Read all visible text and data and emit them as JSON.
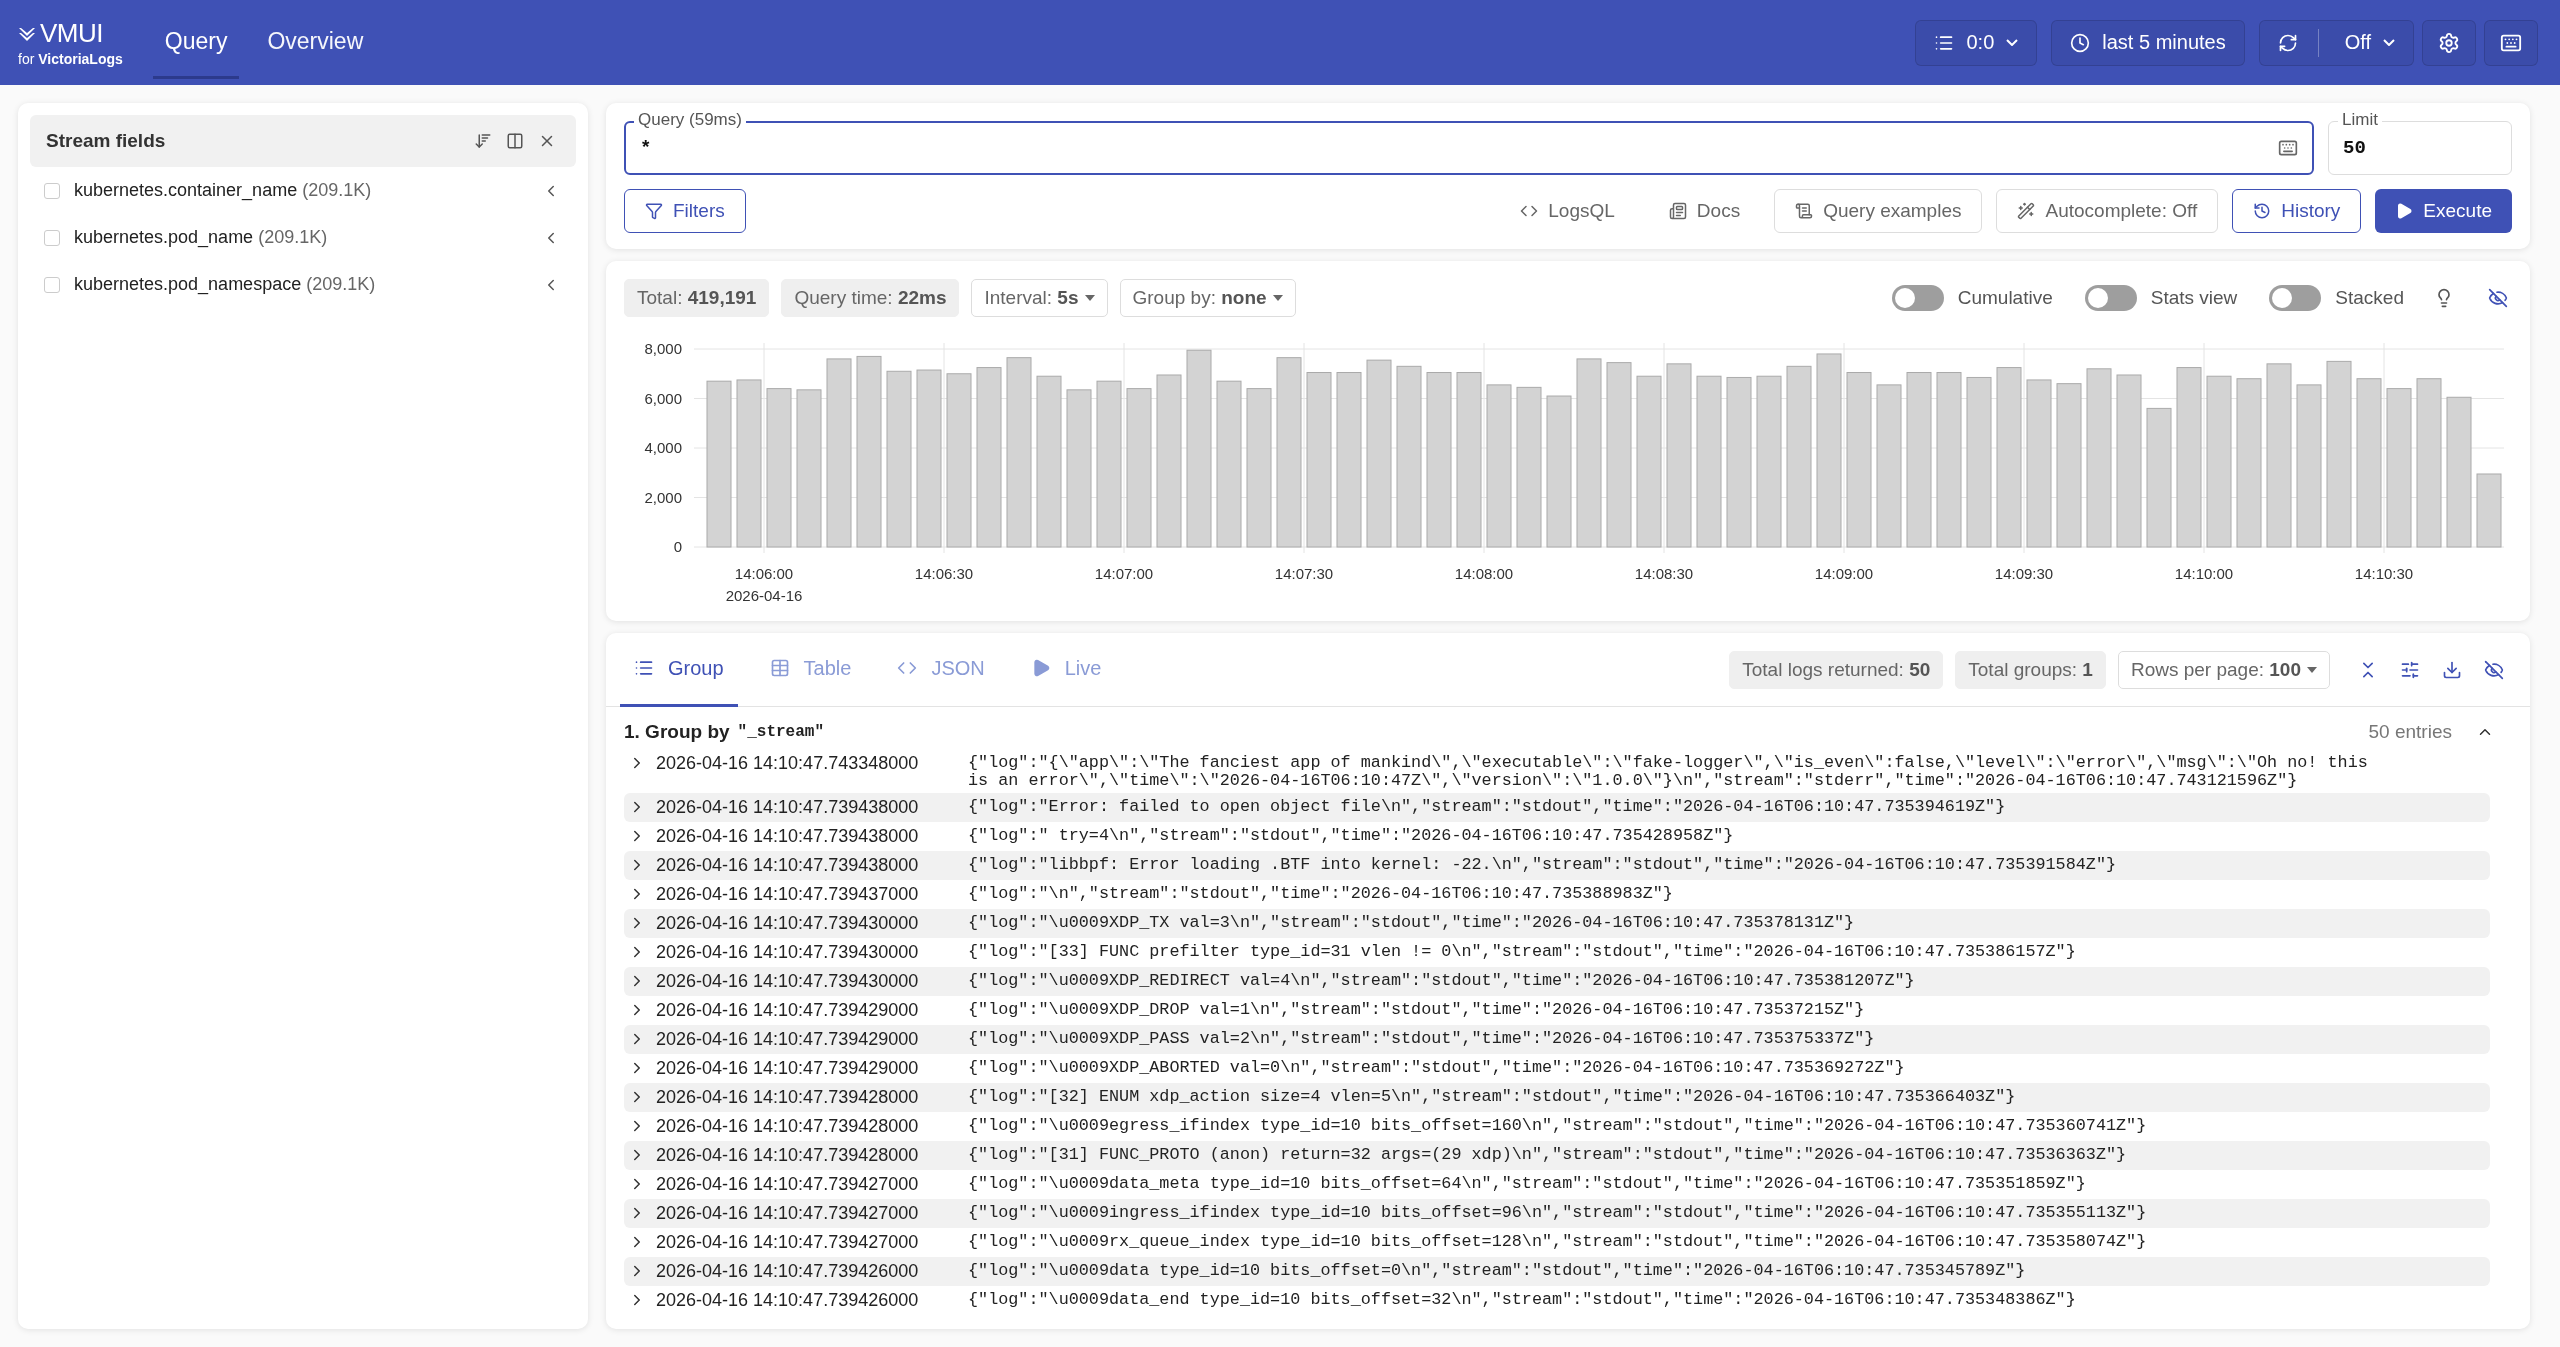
{
  "header": {
    "logo": {
      "title": "VMUI",
      "subtitle": "for **VictoriaLogs**"
    },
    "nav": [
      {
        "label": "Query",
        "selected": true
      },
      {
        "label": "Overview",
        "selected": false
      }
    ],
    "tenant": "0:0",
    "time_range": "last 5 minutes",
    "refresh": "Off"
  },
  "sidebar": {
    "title": "Stream fields",
    "fields": [
      {
        "name": "kubernetes.container_name",
        "count": "(209.1K)",
        "checked": false
      },
      {
        "name": "kubernetes.pod_name",
        "count": "(209.1K)",
        "checked": false
      },
      {
        "name": "kubernetes.pod_namespace",
        "count": "(209.1K)",
        "checked": false
      }
    ]
  },
  "query": {
    "label": "Query (59ms)",
    "value": "*",
    "limit_label": "Limit",
    "limit": "50",
    "buttons": [
      {
        "kind": "outline",
        "label": "Filters"
      },
      {
        "kind": "text",
        "label": "LogsQL"
      },
      {
        "kind": "text",
        "label": "Docs"
      },
      {
        "kind": "plain",
        "label": "Query examples"
      },
      {
        "kind": "plain",
        "label": "Autocomplete: Off"
      },
      {
        "kind": "outline",
        "label": "History"
      },
      {
        "kind": "primary",
        "label": "Execute"
      }
    ]
  },
  "stats": {
    "chips": [
      {
        "kind": "chip",
        "text": "Total: **419,191**"
      },
      {
        "kind": "chip",
        "text": "Query time: **22ms**"
      },
      {
        "kind": "dropdown",
        "text": "Interval: **5s**"
      },
      {
        "kind": "dropdown",
        "text": "Group by: **none**"
      }
    ],
    "toggles": [
      {
        "label": "Cumulative",
        "on": false
      },
      {
        "label": "Stats view",
        "on": false
      },
      {
        "label": "Stacked",
        "on": false
      }
    ],
    "chart_data": {
      "type": "bar",
      "grid": true,
      "ylim": [
        0,
        8000
      ],
      "yticks": [
        {
          "value": 0,
          "label": "0"
        },
        {
          "value": 2000,
          "label": "2,000"
        },
        {
          "value": 4000,
          "label": "4,000"
        },
        {
          "value": 6000,
          "label": "6,000"
        },
        {
          "value": 8000,
          "label": "8,000"
        }
      ],
      "categories": [
        null,
        null,
        "14:06:00",
        null,
        null,
        null,
        null,
        null,
        "14:06:30",
        null,
        null,
        null,
        null,
        null,
        "14:07:00",
        null,
        null,
        null,
        null,
        null,
        "14:07:30",
        null,
        null,
        null,
        null,
        null,
        "14:08:00",
        null,
        null,
        null,
        null,
        null,
        "14:08:30",
        null,
        null,
        null,
        null,
        null,
        "14:09:00",
        null,
        null,
        null,
        null,
        null,
        "14:09:30",
        null,
        null,
        null,
        null,
        null,
        "14:10:00",
        null,
        null,
        null,
        null,
        null,
        "14:10:30",
        null,
        null,
        null
      ],
      "values": [
        6700,
        6750,
        6400,
        6350,
        7600,
        7700,
        7100,
        7150,
        7000,
        7250,
        7650,
        6900,
        6350,
        6700,
        6400,
        6950,
        7950,
        6700,
        6400,
        7650,
        7050,
        7050,
        7550,
        7300,
        7050,
        7050,
        6550,
        6450,
        6100,
        7600,
        7450,
        6900,
        7400,
        6900,
        6850,
        6900,
        7300,
        7800,
        7050,
        6550,
        7050,
        7050,
        6850,
        7250,
        6750,
        6600,
        7200,
        6950,
        5600,
        7250,
        6900,
        6800,
        7400,
        6550,
        7500,
        6800,
        6400,
        6800,
        6050,
        2950
      ],
      "annotations": [
        "2026-04-16"
      ]
    }
  },
  "results": {
    "tabs": [
      {
        "label": "Group",
        "selected": true
      },
      {
        "label": "Table",
        "selected": false
      },
      {
        "label": "JSON",
        "selected": false
      },
      {
        "label": "Live",
        "selected": false
      }
    ],
    "chips": [
      {
        "kind": "chip",
        "text": "Total logs returned: **50**"
      },
      {
        "kind": "chip",
        "text": "Total groups: **1**"
      },
      {
        "kind": "dropdown",
        "text": "Rows per page: **100**"
      }
    ],
    "group": {
      "title": "1. Group by",
      "key": "\"_stream\"",
      "entries": "50 entries"
    },
    "logs": [
      {
        "time": "2026-04-16 14:10:47.743348000",
        "message": "{\"log\":\"{\\\"app\\\":\\\"The fanciest app of mankind\\\",\\\"executable\\\":\\\"fake-logger\\\",\\\"is_even\\\":false,\\\"level\\\":\\\"error\\\",\\\"msg\\\":\\\"Oh no! this is an error\\\",\\\"time\\\":\\\"2026-04-16T06:10:47Z\\\",\\\"version\\\":\\\"1.0.0\\\"}\\n\",\"stream\":\"stderr\",\"time\":\"2026-04-16T06:10:47.743121596Z\"}"
      },
      {
        "time": "2026-04-16 14:10:47.739438000",
        "message": "{\"log\":\"Error: failed to open object file\\n\",\"stream\":\"stdout\",\"time\":\"2026-04-16T06:10:47.735394619Z\"}"
      },
      {
        "time": "2026-04-16 14:10:47.739438000",
        "message": "{\"log\":\" try=4\\n\",\"stream\":\"stdout\",\"time\":\"2026-04-16T06:10:47.735428958Z\"}"
      },
      {
        "time": "2026-04-16 14:10:47.739438000",
        "message": "{\"log\":\"libbpf: Error loading .BTF into kernel: -22.\\n\",\"stream\":\"stdout\",\"time\":\"2026-04-16T06:10:47.735391584Z\"}"
      },
      {
        "time": "2026-04-16 14:10:47.739437000",
        "message": "{\"log\":\"\\n\",\"stream\":\"stdout\",\"time\":\"2026-04-16T06:10:47.735388983Z\"}"
      },
      {
        "time": "2026-04-16 14:10:47.739430000",
        "message": "{\"log\":\"\\u0009XDP_TX val=3\\n\",\"stream\":\"stdout\",\"time\":\"2026-04-16T06:10:47.735378131Z\"}"
      },
      {
        "time": "2026-04-16 14:10:47.739430000",
        "message": "{\"log\":\"[33] FUNC prefilter type_id=31 vlen != 0\\n\",\"stream\":\"stdout\",\"time\":\"2026-04-16T06:10:47.735386157Z\"}"
      },
      {
        "time": "2026-04-16 14:10:47.739430000",
        "message": "{\"log\":\"\\u0009XDP_REDIRECT val=4\\n\",\"stream\":\"stdout\",\"time\":\"2026-04-16T06:10:47.735381207Z\"}"
      },
      {
        "time": "2026-04-16 14:10:47.739429000",
        "message": "{\"log\":\"\\u0009XDP_DROP val=1\\n\",\"stream\":\"stdout\",\"time\":\"2026-04-16T06:10:47.73537215Z\"}"
      },
      {
        "time": "2026-04-16 14:10:47.739429000",
        "message": "{\"log\":\"\\u0009XDP_PASS val=2\\n\",\"stream\":\"stdout\",\"time\":\"2026-04-16T06:10:47.735375337Z\"}"
      },
      {
        "time": "2026-04-16 14:10:47.739429000",
        "message": "{\"log\":\"\\u0009XDP_ABORTED val=0\\n\",\"stream\":\"stdout\",\"time\":\"2026-04-16T06:10:47.735369272Z\"}"
      },
      {
        "time": "2026-04-16 14:10:47.739428000",
        "message": "{\"log\":\"[32] ENUM xdp_action size=4 vlen=5\\n\",\"stream\":\"stdout\",\"time\":\"2026-04-16T06:10:47.735366403Z\"}"
      },
      {
        "time": "2026-04-16 14:10:47.739428000",
        "message": "{\"log\":\"\\u0009egress_ifindex type_id=10 bits_offset=160\\n\",\"stream\":\"stdout\",\"time\":\"2026-04-16T06:10:47.735360741Z\"}"
      },
      {
        "time": "2026-04-16 14:10:47.739428000",
        "message": "{\"log\":\"[31] FUNC_PROTO (anon) return=32 args=(29 xdp)\\n\",\"stream\":\"stdout\",\"time\":\"2026-04-16T06:10:47.73536363Z\"}"
      },
      {
        "time": "2026-04-16 14:10:47.739427000",
        "message": "{\"log\":\"\\u0009data_meta type_id=10 bits_offset=64\\n\",\"stream\":\"stdout\",\"time\":\"2026-04-16T06:10:47.735351859Z\"}"
      },
      {
        "time": "2026-04-16 14:10:47.739427000",
        "message": "{\"log\":\"\\u0009ingress_ifindex type_id=10 bits_offset=96\\n\",\"stream\":\"stdout\",\"time\":\"2026-04-16T06:10:47.735355113Z\"}"
      },
      {
        "time": "2026-04-16 14:10:47.739427000",
        "message": "{\"log\":\"\\u0009rx_queue_index type_id=10 bits_offset=128\\n\",\"stream\":\"stdout\",\"time\":\"2026-04-16T06:10:47.735358074Z\"}"
      },
      {
        "time": "2026-04-16 14:10:47.739426000",
        "message": "{\"log\":\"\\u0009data type_id=10 bits_offset=0\\n\",\"stream\":\"stdout\",\"time\":\"2026-04-16T06:10:47.735345789Z\"}"
      },
      {
        "time": "2026-04-16 14:10:47.739426000",
        "message": "{\"log\":\"\\u0009data_end type_id=10 bits_offset=32\\n\",\"stream\":\"stdout\",\"time\":\"2026-04-16T06:10:47.735348386Z\"}"
      }
    ]
  }
}
